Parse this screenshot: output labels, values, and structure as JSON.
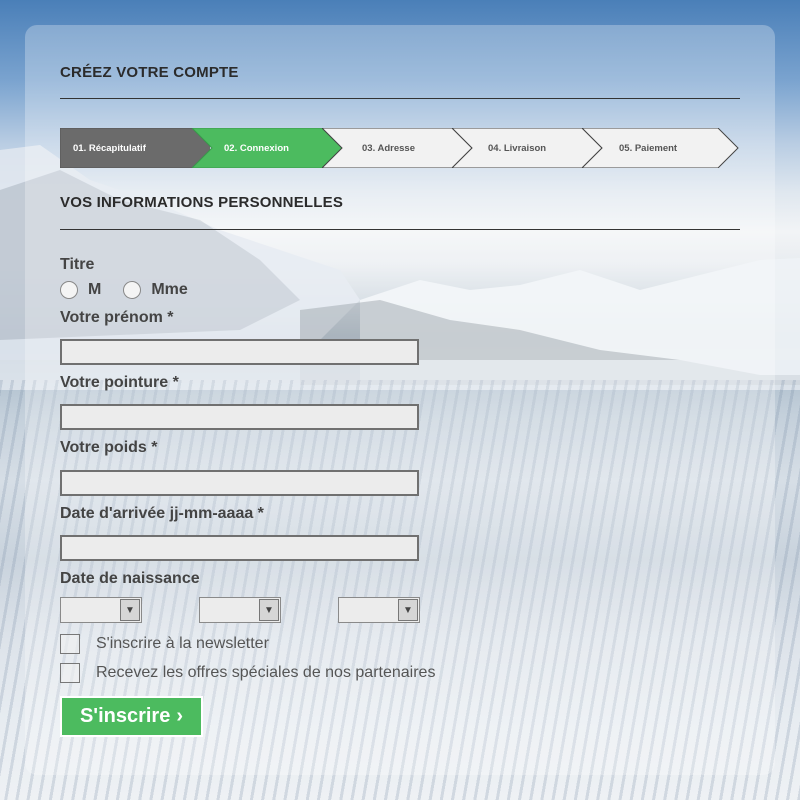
{
  "header": {
    "title": "CRÉEZ VOTRE COMPTE"
  },
  "steps": [
    {
      "label": "01. Récapitulatif",
      "state": "done"
    },
    {
      "label": "02. Connexion",
      "state": "active"
    },
    {
      "label": "03. Adresse",
      "state": "todo"
    },
    {
      "label": "04. Livraison",
      "state": "todo"
    },
    {
      "label": "05. Paiement",
      "state": "todo"
    }
  ],
  "section": {
    "title": "VOS INFORMATIONS PERSONNELLES"
  },
  "form": {
    "titre_label": "Titre",
    "titre_options": [
      "M",
      "Mme"
    ],
    "prenom_label": "Votre prénom *",
    "pointure_label": "Votre pointure *",
    "poids_label": "Votre poids *",
    "arrivee_label": "Date d'arrivée jj-mm-aaaa *",
    "naissance_label": "Date de naissance",
    "newsletter_label": "S'inscrire à la newsletter",
    "offres_label": "Recevez les offres spéciales de nos partenaires",
    "submit_label": "S'inscrire"
  },
  "colors": {
    "step_done": "#6b6b6b",
    "step_active": "#4cbb5f",
    "step_todo": "#f2f2f2",
    "accent": "#4cbb5f"
  },
  "icons": {
    "submit": "chevron-right-icon",
    "select": "caret-down-icon"
  }
}
